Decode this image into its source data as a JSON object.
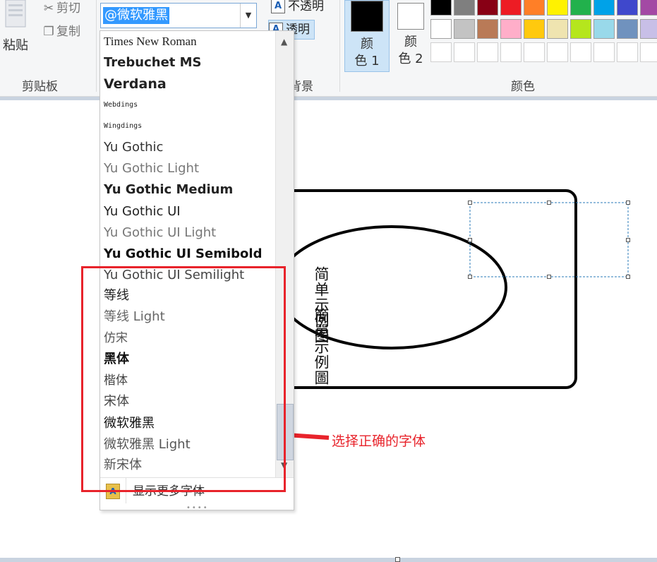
{
  "clipboard": {
    "paste_label": "粘贴",
    "cut_label": "剪切",
    "copy_label": "复制",
    "group_label": "剪贴板"
  },
  "font": {
    "selected": "@微软雅黑",
    "items": [
      "Times New Roman",
      "Trebuchet MS",
      "Verdana",
      "Webdings",
      "Wingdings",
      "Yu Gothic",
      "Yu Gothic Light",
      "Yu Gothic Medium",
      "Yu Gothic UI",
      "Yu Gothic UI Light",
      "Yu Gothic UI Semibold",
      "Yu Gothic UI Semilight",
      "等线",
      "等线 Light",
      "仿宋",
      "黑体",
      "楷体",
      "宋体",
      "微软雅黑",
      "微软雅黑 Light",
      "新宋体"
    ],
    "more_fonts_label": "显示更多字体"
  },
  "background": {
    "opaque_label": "不透明",
    "transparent_label": "透明",
    "group_label_partial": "背景"
  },
  "colors": {
    "color1_label": "颜色 1",
    "color2_label": "颜色 2",
    "color1_value": "#000000",
    "color2_value": "#ffffff",
    "group_label": "颜色",
    "palette_row1": [
      "#000000",
      "#7f7f7f",
      "#880015",
      "#ed1c24",
      "#ff7f27",
      "#fff200",
      "#22b14c",
      "#00a2e8",
      "#3f48cc",
      "#a349a4"
    ],
    "palette_row2": [
      "#ffffff",
      "#c3c3c3",
      "#b97a57",
      "#ffaec9",
      "#ffc90e",
      "#efe4b0",
      "#b5e61d",
      "#99d9ea",
      "#7092be",
      "#c8bfe7"
    ]
  },
  "canvas": {
    "text_simplified": "简单示例图",
    "text_traditional": "簡單示例圖"
  },
  "annotation": {
    "text": "选择正确的字体",
    "color": "#e8232b"
  }
}
